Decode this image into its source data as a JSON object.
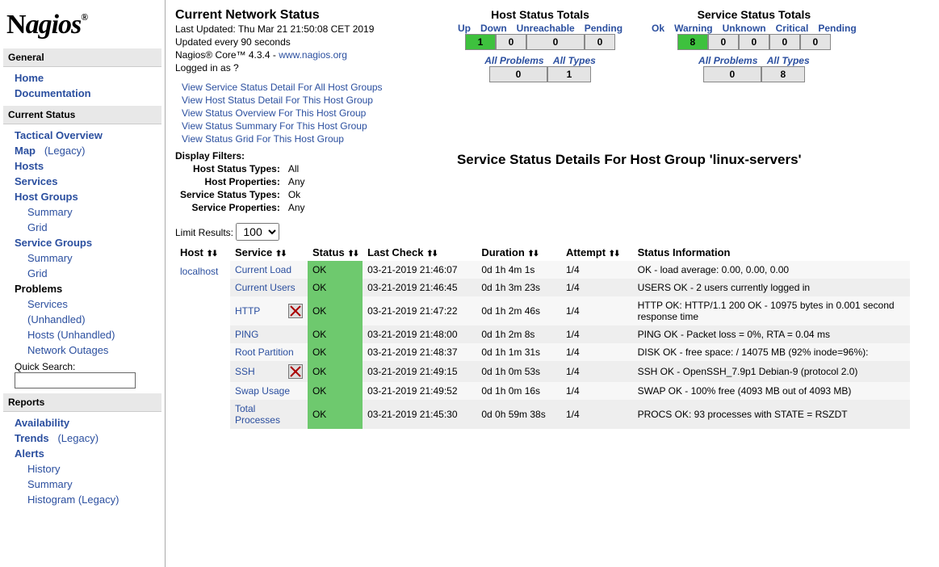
{
  "logo": "Nagios",
  "sidebar": {
    "general": {
      "title": "General",
      "home": "Home",
      "documentation": "Documentation"
    },
    "current": {
      "title": "Current Status",
      "tactical": "Tactical Overview",
      "map": "Map",
      "map_legacy": "(Legacy)",
      "hosts": "Hosts",
      "services": "Services",
      "hostgroups": "Host Groups",
      "summary": "Summary",
      "grid": "Grid",
      "servicegroups": "Service Groups",
      "problems": "Problems",
      "services_unhandled": "Services",
      "unhandled": "(Unhandled)",
      "hosts_unhandled": "Hosts",
      "network_outages": "Network Outages",
      "quick_search": "Quick Search:"
    },
    "reports": {
      "title": "Reports",
      "availability": "Availability",
      "trends": "Trends",
      "trends_legacy": "(Legacy)",
      "alerts": "Alerts",
      "history": "History",
      "summary": "Summary",
      "histogram": "Histogram (Legacy)"
    }
  },
  "status": {
    "title": "Current Network Status",
    "last_updated": "Last Updated: Thu Mar 21 21:50:08 CET 2019",
    "updated_every": "Updated every 90 seconds",
    "version_pre": "Nagios® Core™ 4.3.4 - ",
    "version_link": "www.nagios.org",
    "logged_in": "Logged in as ?"
  },
  "viewlinks": {
    "l1": "View Service Status Detail For All Host Groups",
    "l2": "View Host Status Detail For This Host Group",
    "l3": "View Status Overview For This Host Group",
    "l4": "View Status Summary For This Host Group",
    "l5": "View Status Grid For This Host Group"
  },
  "host_totals": {
    "title": "Host Status Totals",
    "hdr_up": "Up",
    "hdr_down": "Down",
    "hdr_unreach": "Unreachable",
    "hdr_pending": "Pending",
    "up": "1",
    "down": "0",
    "unreach": "0",
    "pending": "0",
    "all_problems": "All Problems",
    "all_types": "All Types",
    "prob": "0",
    "types": "1"
  },
  "svc_totals": {
    "title": "Service Status Totals",
    "hdr_ok": "Ok",
    "hdr_warn": "Warning",
    "hdr_unk": "Unknown",
    "hdr_crit": "Critical",
    "hdr_pend": "Pending",
    "ok": "8",
    "warn": "0",
    "unk": "0",
    "crit": "0",
    "pend": "0",
    "all_problems": "All Problems",
    "all_types": "All Types",
    "prob": "0",
    "types": "8"
  },
  "filters": {
    "title": "Display Filters:",
    "host_status_types": "Host Status Types:",
    "host_status_val": "All",
    "host_props": "Host Properties:",
    "host_props_val": "Any",
    "svc_status_types": "Service Status Types:",
    "svc_status_val": "Ok",
    "svc_props": "Service Properties:",
    "svc_props_val": "Any"
  },
  "detail_title": "Service Status Details For Host Group 'linux-servers'",
  "limit": {
    "label": "Limit Results:",
    "value": "100"
  },
  "table": {
    "hdr_host": "Host",
    "hdr_service": "Service",
    "hdr_status": "Status",
    "hdr_lastcheck": "Last Check",
    "hdr_duration": "Duration",
    "hdr_attempt": "Attempt",
    "hdr_info": "Status Information",
    "host": "localhost",
    "rows": [
      {
        "svc": "Current Load",
        "icon": false,
        "status": "OK",
        "last": "03-21-2019 21:46:07",
        "dur": "0d 1h 4m 1s",
        "att": "1/4",
        "info": "OK - load average: 0.00, 0.00, 0.00"
      },
      {
        "svc": "Current Users",
        "icon": false,
        "status": "OK",
        "last": "03-21-2019 21:46:45",
        "dur": "0d 1h 3m 23s",
        "att": "1/4",
        "info": "USERS OK - 2 users currently logged in"
      },
      {
        "svc": "HTTP",
        "icon": true,
        "status": "OK",
        "last": "03-21-2019 21:47:22",
        "dur": "0d 1h 2m 46s",
        "att": "1/4",
        "info": "HTTP OK: HTTP/1.1 200 OK - 10975 bytes in 0.001 second response time"
      },
      {
        "svc": "PING",
        "icon": false,
        "status": "OK",
        "last": "03-21-2019 21:48:00",
        "dur": "0d 1h 2m 8s",
        "att": "1/4",
        "info": "PING OK - Packet loss = 0%, RTA = 0.04 ms"
      },
      {
        "svc": "Root Partition",
        "icon": false,
        "status": "OK",
        "last": "03-21-2019 21:48:37",
        "dur": "0d 1h 1m 31s",
        "att": "1/4",
        "info": "DISK OK - free space: / 14075 MB (92% inode=96%):"
      },
      {
        "svc": "SSH",
        "icon": true,
        "status": "OK",
        "last": "03-21-2019 21:49:15",
        "dur": "0d 1h 0m 53s",
        "att": "1/4",
        "info": "SSH OK - OpenSSH_7.9p1 Debian-9 (protocol 2.0)"
      },
      {
        "svc": "Swap Usage",
        "icon": false,
        "status": "OK",
        "last": "03-21-2019 21:49:52",
        "dur": "0d 1h 0m 16s",
        "att": "1/4",
        "info": "SWAP OK - 100% free (4093 MB out of 4093 MB)"
      },
      {
        "svc": "Total Processes",
        "icon": false,
        "status": "OK",
        "last": "03-21-2019 21:45:30",
        "dur": "0d 0h 59m 38s",
        "att": "1/4",
        "info": "PROCS OK: 93 processes with STATE = RSZDT"
      }
    ]
  }
}
